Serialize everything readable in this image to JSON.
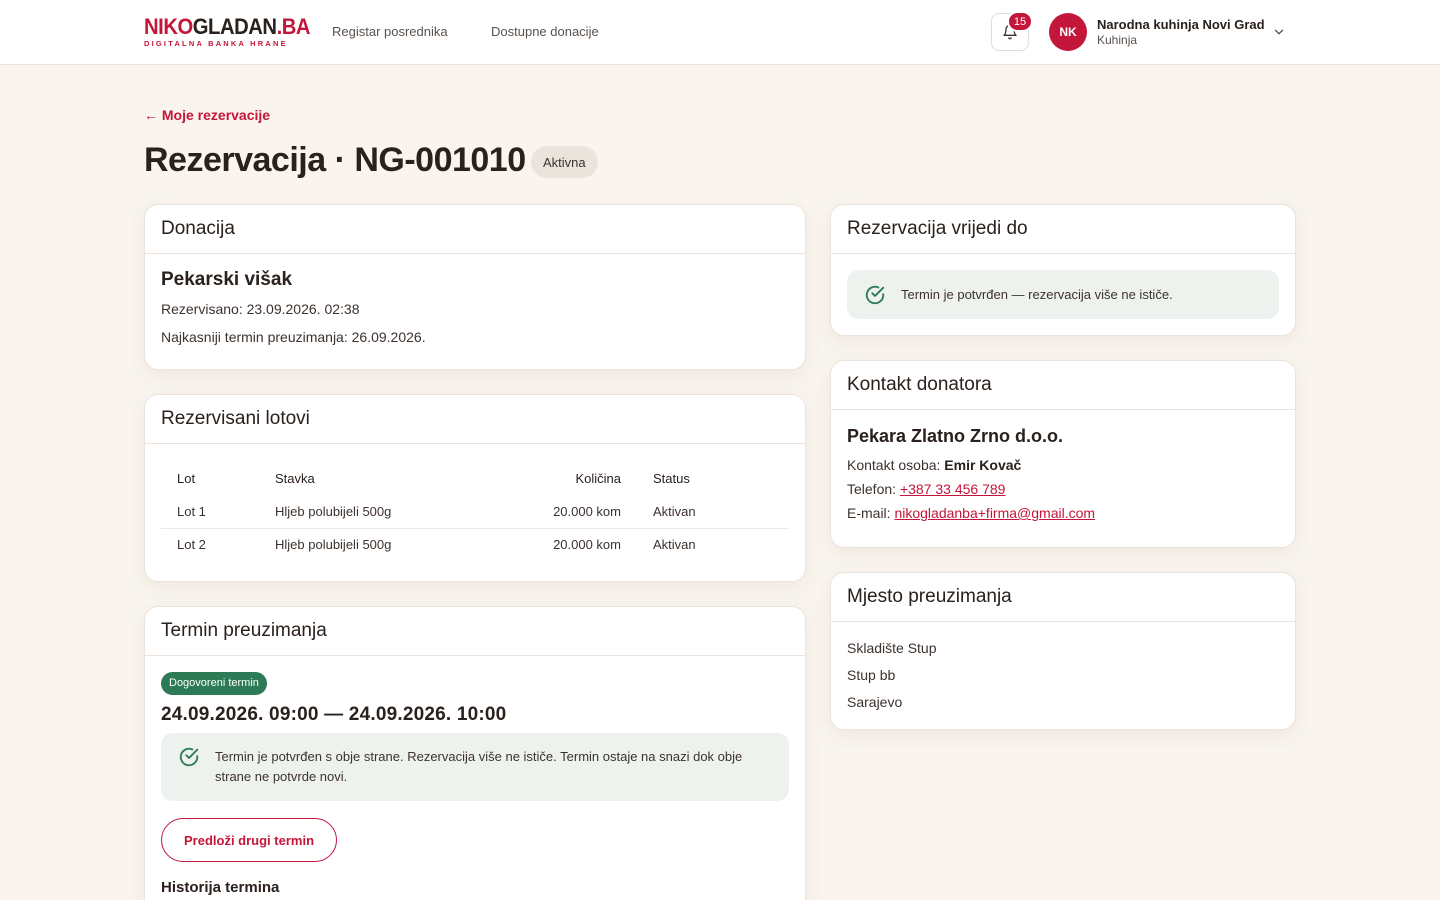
{
  "header": {
    "logo": {
      "part1": "NIKO",
      "part2": "GLADAN",
      "part3": ".BA",
      "tagline": "DIGITALNA BANKA HRANE"
    },
    "nav": [
      "Registar posrednika",
      "Dostupne donacije"
    ],
    "notification_count": "15",
    "user": {
      "initials": "NK",
      "name": "Narodna kuhinja Novi Grad",
      "role": "Kuhinja"
    }
  },
  "page": {
    "back_link": "← Moje rezervacije",
    "title": "Rezervacija · NG-001010",
    "status": "Aktivna"
  },
  "donation": {
    "heading": "Donacija",
    "title": "Pekarski višak",
    "reserved": "Rezervisano: 23.09.2026. 02:38",
    "deadline": "Najkasniji termin preuzimanja: 26.09.2026."
  },
  "lots": {
    "heading": "Rezervisani lotovi",
    "columns": [
      "Lot",
      "Stavka",
      "Količina",
      "Status"
    ],
    "rows": [
      [
        "Lot 1",
        "Hljeb polubijeli 500g",
        "20.000 kom",
        "Aktivan"
      ],
      [
        "Lot 2",
        "Hljeb polubijeli 500g",
        "20.000 kom",
        "Aktivan"
      ]
    ]
  },
  "pickup_slot": {
    "heading": "Termin preuzimanja",
    "tag": "Dogovoreni termin",
    "range": "24.09.2026. 09:00 — 24.09.2026. 10:00",
    "info": "Termin je potvrđen s obje strane. Rezervacija više ne ističe. Termin ostaje na snazi dok obje strane ne potvrde novi.",
    "propose_button": "Predloži drugi termin",
    "history_heading": "Historija termina"
  },
  "validity": {
    "heading": "Rezervacija vrijedi do",
    "info": "Termin je potvrđen — rezervacija više ne ističe."
  },
  "contact": {
    "heading": "Kontakt donatora",
    "company": "Pekara Zlatno Zrno d.o.o.",
    "person_label": "Kontakt osoba:",
    "person": "Emir Kovač",
    "phone_label": "Telefon:",
    "phone": "+387 33 456 789",
    "email_label": "E-mail:",
    "email": "nikogladanba+firma@gmail.com"
  },
  "location": {
    "heading": "Mjesto preuzimanja",
    "lines": [
      "Skladište Stup",
      "Stup bb",
      "Sarajevo"
    ]
  },
  "colors": {
    "brand": "#c4163a",
    "success": "#2d7a57",
    "background": "#f9f4ee"
  }
}
